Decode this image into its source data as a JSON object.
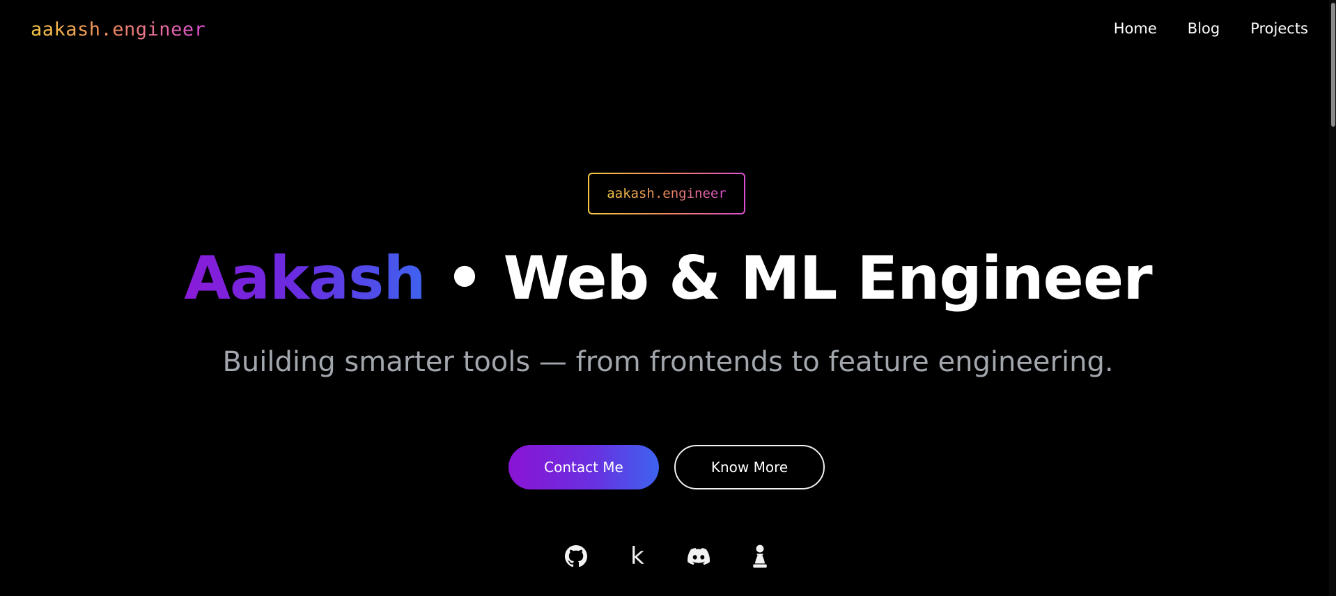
{
  "header": {
    "brand": "aakash.engineer",
    "nav": [
      {
        "label": "Home"
      },
      {
        "label": "Blog"
      },
      {
        "label": "Projects"
      }
    ]
  },
  "hero": {
    "badge": "aakash.engineer",
    "headline_name": "Aakash",
    "headline_rest": " • Web & ML Engineer",
    "subtitle": "Building smarter tools — from frontends to feature engineering.",
    "buttons": {
      "primary_label": "Contact Me",
      "secondary_label": "Know More"
    },
    "socials": [
      {
        "icon": "github-icon"
      },
      {
        "icon": "kaggle-icon",
        "glyph": "k"
      },
      {
        "icon": "discord-icon"
      },
      {
        "icon": "chess-pawn-icon"
      }
    ]
  },
  "colors": {
    "background": "#000000",
    "brand_gradient": [
      "#f6c945",
      "#f08a5d",
      "#d94fd1"
    ],
    "name_gradient": [
      "#8a1bd8",
      "#3e63ef"
    ],
    "subtitle": "#a2a6ad"
  }
}
